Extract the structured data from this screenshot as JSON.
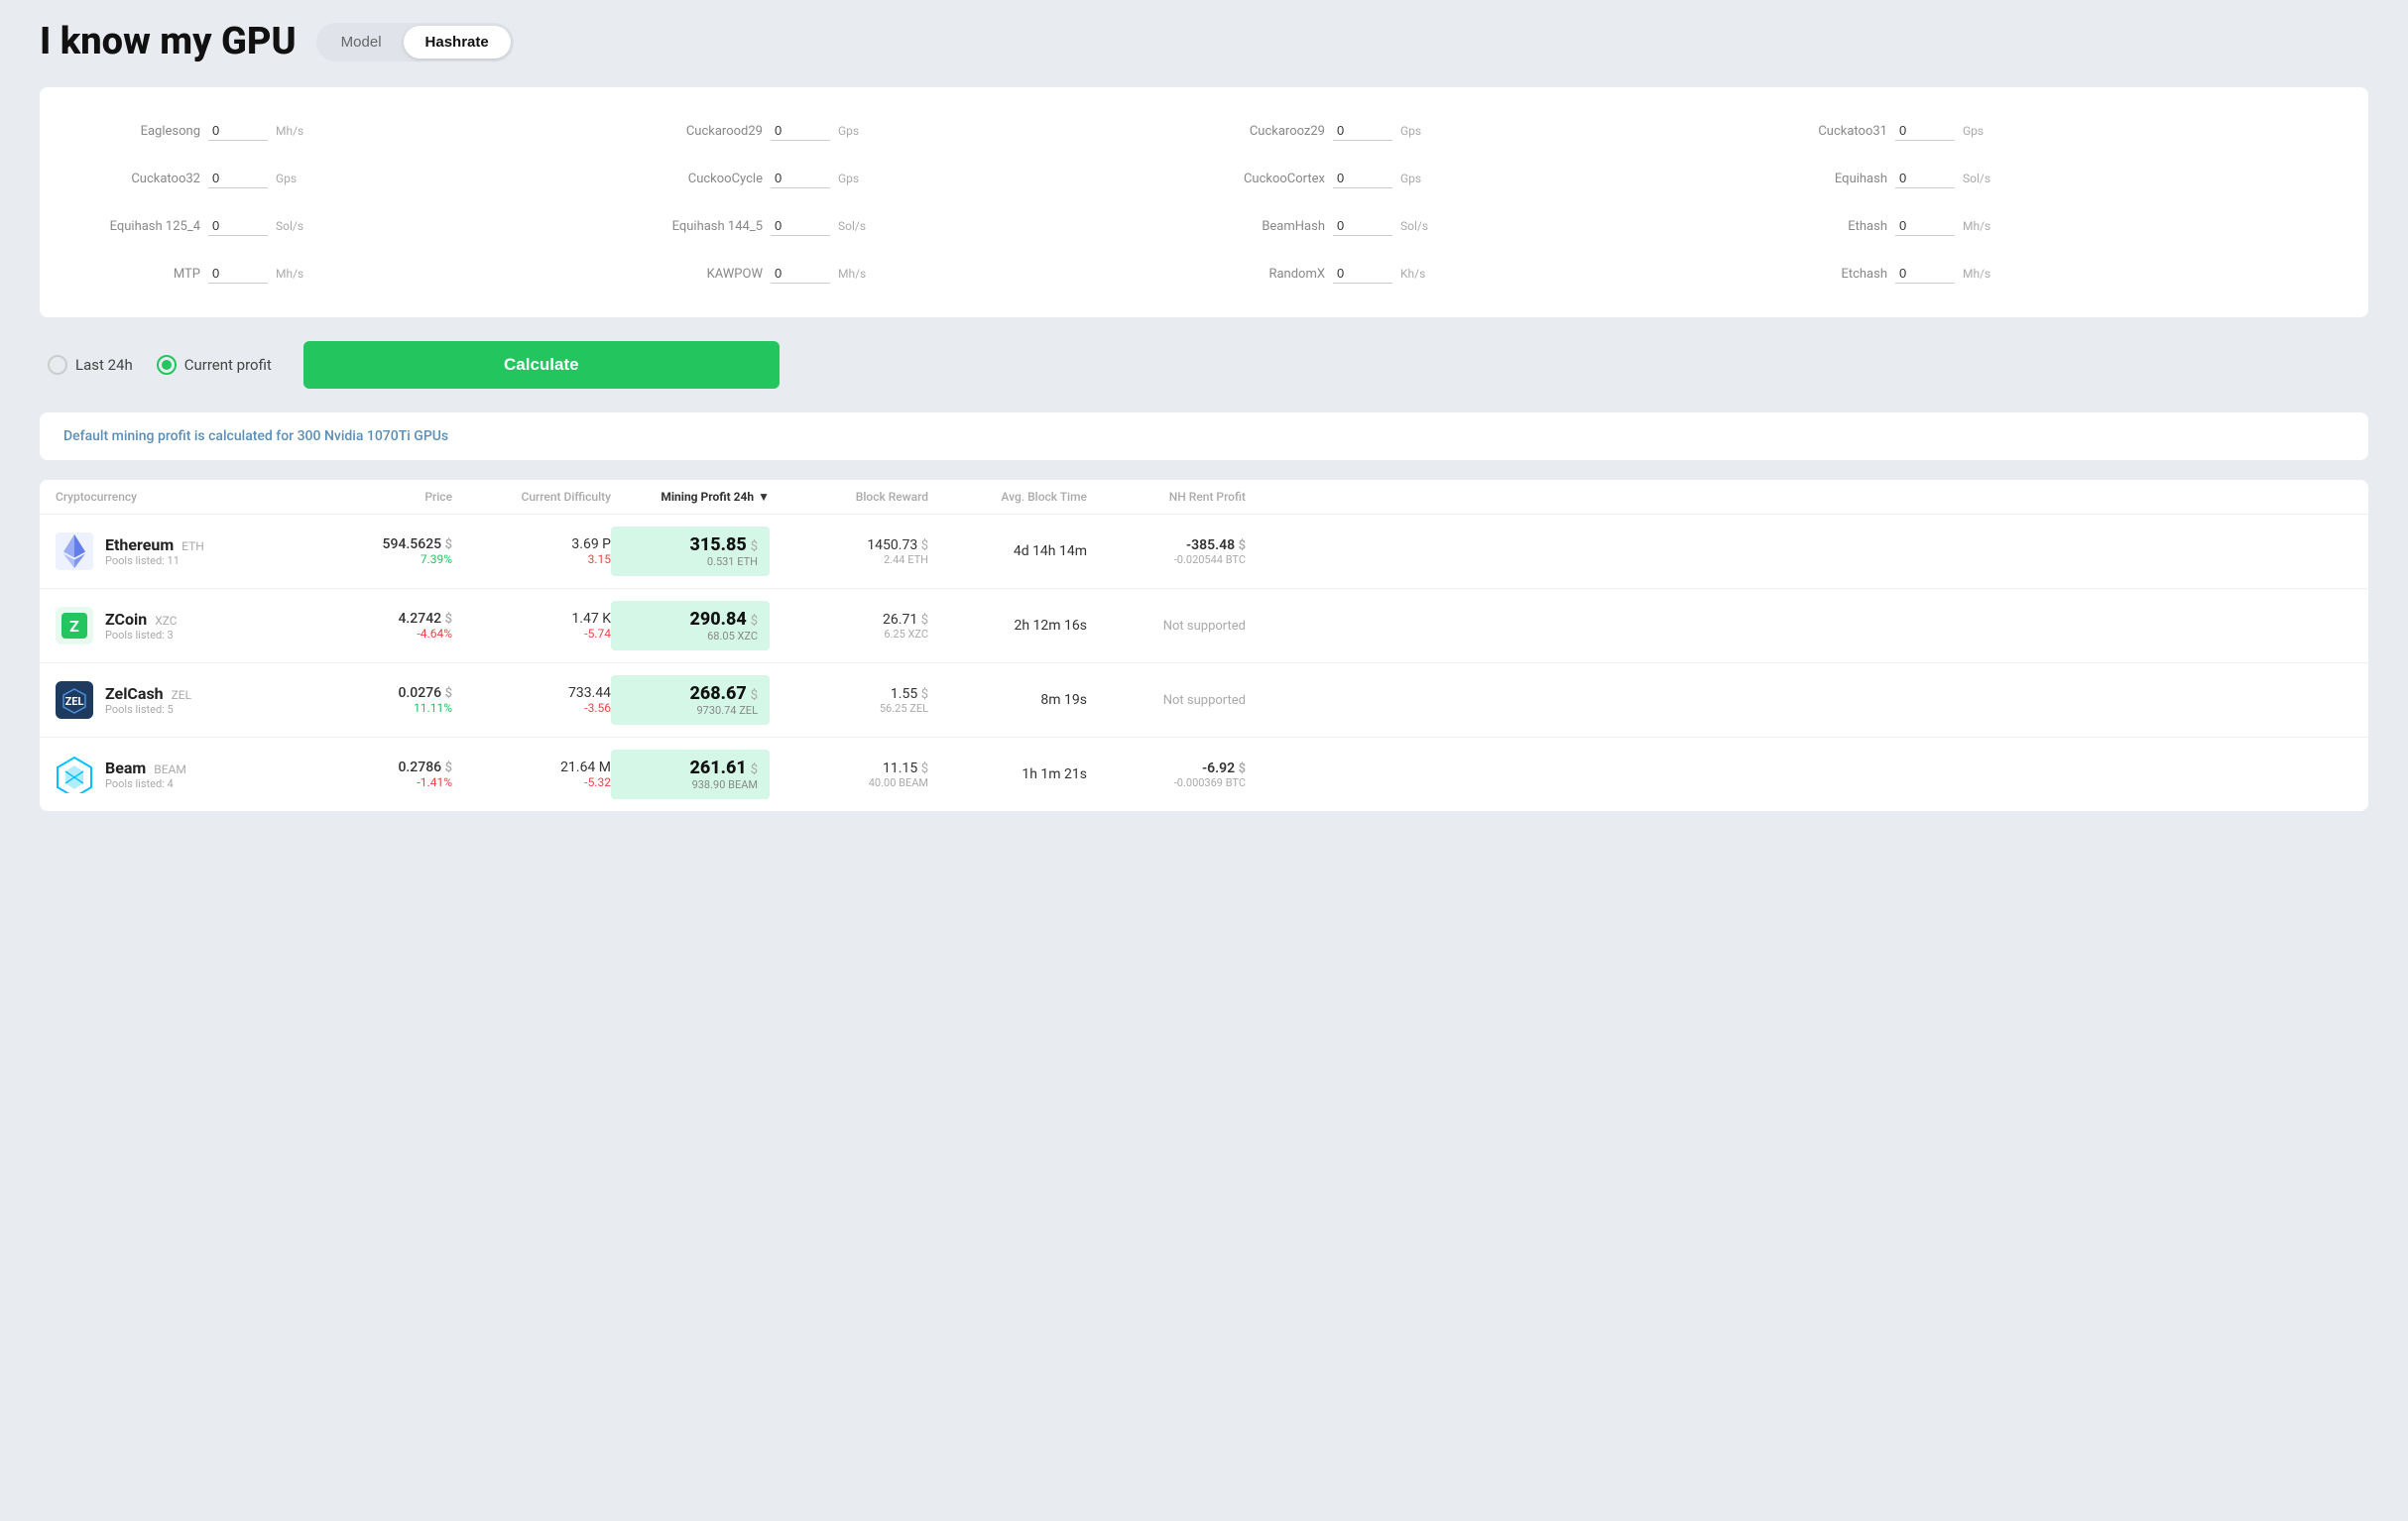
{
  "header": {
    "title": "I know my GPU",
    "toggle_model": "Model",
    "toggle_hashrate": "Hashrate",
    "active_toggle": "Hashrate"
  },
  "hashrate_inputs": [
    {
      "label": "Eaglesong",
      "value": "0",
      "unit": "Mh/s"
    },
    {
      "label": "Cuckarood29",
      "value": "0",
      "unit": "Gps"
    },
    {
      "label": "Cuckarooz29",
      "value": "0",
      "unit": "Gps"
    },
    {
      "label": "Cuckatoo31",
      "value": "0",
      "unit": "Gps"
    },
    {
      "label": "Cuckatoo32",
      "value": "0",
      "unit": "Gps"
    },
    {
      "label": "CuckooCycle",
      "value": "0",
      "unit": "Gps"
    },
    {
      "label": "CuckooCortex",
      "value": "0",
      "unit": "Gps"
    },
    {
      "label": "Equihash",
      "value": "0",
      "unit": "Sol/s"
    },
    {
      "label": "Equihash 125_4",
      "value": "0",
      "unit": "Sol/s"
    },
    {
      "label": "Equihash 144_5",
      "value": "0",
      "unit": "Sol/s"
    },
    {
      "label": "BeamHash",
      "value": "0",
      "unit": "Sol/s"
    },
    {
      "label": "Ethash",
      "value": "0",
      "unit": "Mh/s"
    },
    {
      "label": "MTP",
      "value": "0",
      "unit": "Mh/s"
    },
    {
      "label": "KAWPOW",
      "value": "0",
      "unit": "Mh/s"
    },
    {
      "label": "RandomX",
      "value": "0",
      "unit": "Kh/s"
    },
    {
      "label": "Etchash",
      "value": "0",
      "unit": "Mh/s"
    }
  ],
  "controls": {
    "radio_last24h": "Last 24h",
    "radio_current": "Current profit",
    "selected": "current",
    "calculate_label": "Calculate"
  },
  "info_banner": "Default mining profit is calculated for 300 Nvidia 1070Ti GPUs",
  "table": {
    "columns": [
      "Cryptocurrency",
      "Price",
      "Current Difficulty",
      "Mining Profit 24h",
      "Block Reward",
      "Avg. Block Time",
      "NH Rent Profit"
    ],
    "rows": [
      {
        "icon": "eth",
        "name": "Ethereum",
        "ticker": "ETH",
        "pools": "Pools listed: 11",
        "price": "594.5625",
        "price_change": "7.39%",
        "price_change_type": "positive",
        "difficulty": "3.69 P",
        "difficulty_change": "3.15",
        "difficulty_change_type": "negative",
        "profit": "315.85",
        "profit_sub": "0.531 ETH",
        "block_reward": "1450.73",
        "block_reward_sub": "2.44 ETH",
        "avg_time": "4d 14h 14m",
        "nh_profit": "-385.48",
        "nh_profit_sub": "-0.020544 BTC",
        "nh_supported": true
      },
      {
        "icon": "zcoin",
        "name": "ZCoin",
        "ticker": "XZC",
        "pools": "Pools listed: 3",
        "price": "4.2742",
        "price_change": "-4.64%",
        "price_change_type": "negative",
        "difficulty": "1.47 K",
        "difficulty_change": "-5.74",
        "difficulty_change_type": "negative",
        "profit": "290.84",
        "profit_sub": "68.05 XZC",
        "block_reward": "26.71",
        "block_reward_sub": "6.25 XZC",
        "avg_time": "2h 12m 16s",
        "nh_profit": null,
        "nh_profit_sub": null,
        "nh_supported": false
      },
      {
        "icon": "zelcash",
        "name": "ZelCash",
        "ticker": "ZEL",
        "pools": "Pools listed: 5",
        "price": "0.0276",
        "price_change": "11.11%",
        "price_change_type": "positive",
        "difficulty": "733.44",
        "difficulty_change": "-3.56",
        "difficulty_change_type": "negative",
        "profit": "268.67",
        "profit_sub": "9730.74 ZEL",
        "block_reward": "1.55",
        "block_reward_sub": "56.25 ZEL",
        "avg_time": "8m 19s",
        "nh_profit": null,
        "nh_profit_sub": null,
        "nh_supported": false
      },
      {
        "icon": "beam",
        "name": "Beam",
        "ticker": "BEAM",
        "pools": "Pools listed: 4",
        "price": "0.2786",
        "price_change": "-1.41%",
        "price_change_type": "negative",
        "difficulty": "21.64 M",
        "difficulty_change": "-5.32",
        "difficulty_change_type": "negative",
        "profit": "261.61",
        "profit_sub": "938.90 BEAM",
        "block_reward": "11.15",
        "block_reward_sub": "40.00 BEAM",
        "avg_time": "1h 1m 21s",
        "nh_profit": "-6.92",
        "nh_profit_sub": "-0.000369 BTC",
        "nh_supported": true
      }
    ]
  }
}
